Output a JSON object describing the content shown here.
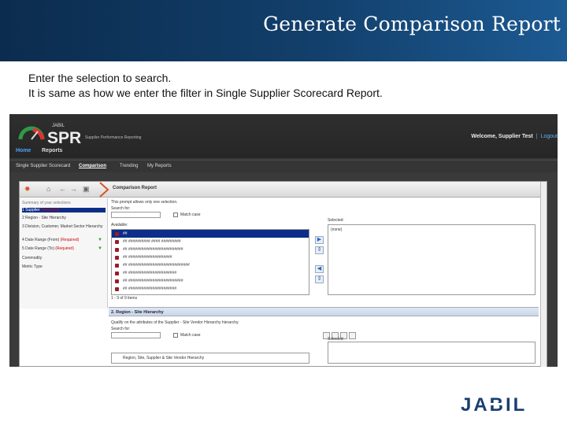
{
  "slide": {
    "title": "Generate Comparison Report",
    "intro_line1": "Enter the selection to search.",
    "intro_line2": "It is same as how we enter the filter in Single Supplier Scorecard Report."
  },
  "app": {
    "logo_small": "JABIL",
    "logo_text": "SPR",
    "logo_tagline": "Supplier Performance Reporting",
    "welcome": "Welcome, Supplier Test",
    "logout": "Logout",
    "nav_primary": [
      "Home",
      "Reports"
    ],
    "nav_secondary": [
      "Single Supplier Scorecard",
      "Comparison",
      "Trending",
      "My Reports"
    ],
    "report_title": "Comparison Report"
  },
  "prompts": {
    "header": "Summary of your selections",
    "items": [
      {
        "label": "1 Supplier",
        "flag": "(Required)"
      },
      {
        "label": "2 Region - Site Hierarchy",
        "flag": ""
      },
      {
        "label": "3 Division, Customer, Market Sector Hierarchy",
        "flag": ""
      },
      {
        "label": "4 Date Range (From)",
        "flag": "(Required)"
      },
      {
        "label": "5 Date Range (To)",
        "flag": "(Required)"
      },
      {
        "label": "Commodity",
        "flag": ""
      },
      {
        "label": "Metric Type",
        "flag": ""
      }
    ]
  },
  "prompt1": {
    "note": "This prompt allows only one selection.",
    "search_label": "Search for:",
    "match_case": "Match case",
    "available_label": "Available:",
    "selected_label": "Selected:",
    "selected_value": "(none)",
    "rows": [
      "##",
      "## ########## #### #########",
      "## #########################",
      "## ####################",
      "## ############################",
      "## ######################",
      "## #########################",
      "## ######################"
    ],
    "pager": "1 - 9 of 9 items"
  },
  "section2": {
    "title": "2. Region - Site Hierarchy",
    "note": "Qualify on the attributes of the Supplier - Site Vendor Hierarchy hierarchy.",
    "search_label": "Search for:",
    "match_case": "Match case",
    "selected_label": "Selected:",
    "tree_item": "Region, Site, Supplier & Site Vendor Hierarchy"
  },
  "brand": {
    "footer_logo": "JABIL",
    "header_color": "#123f6b",
    "accent": "#0c2e88"
  }
}
